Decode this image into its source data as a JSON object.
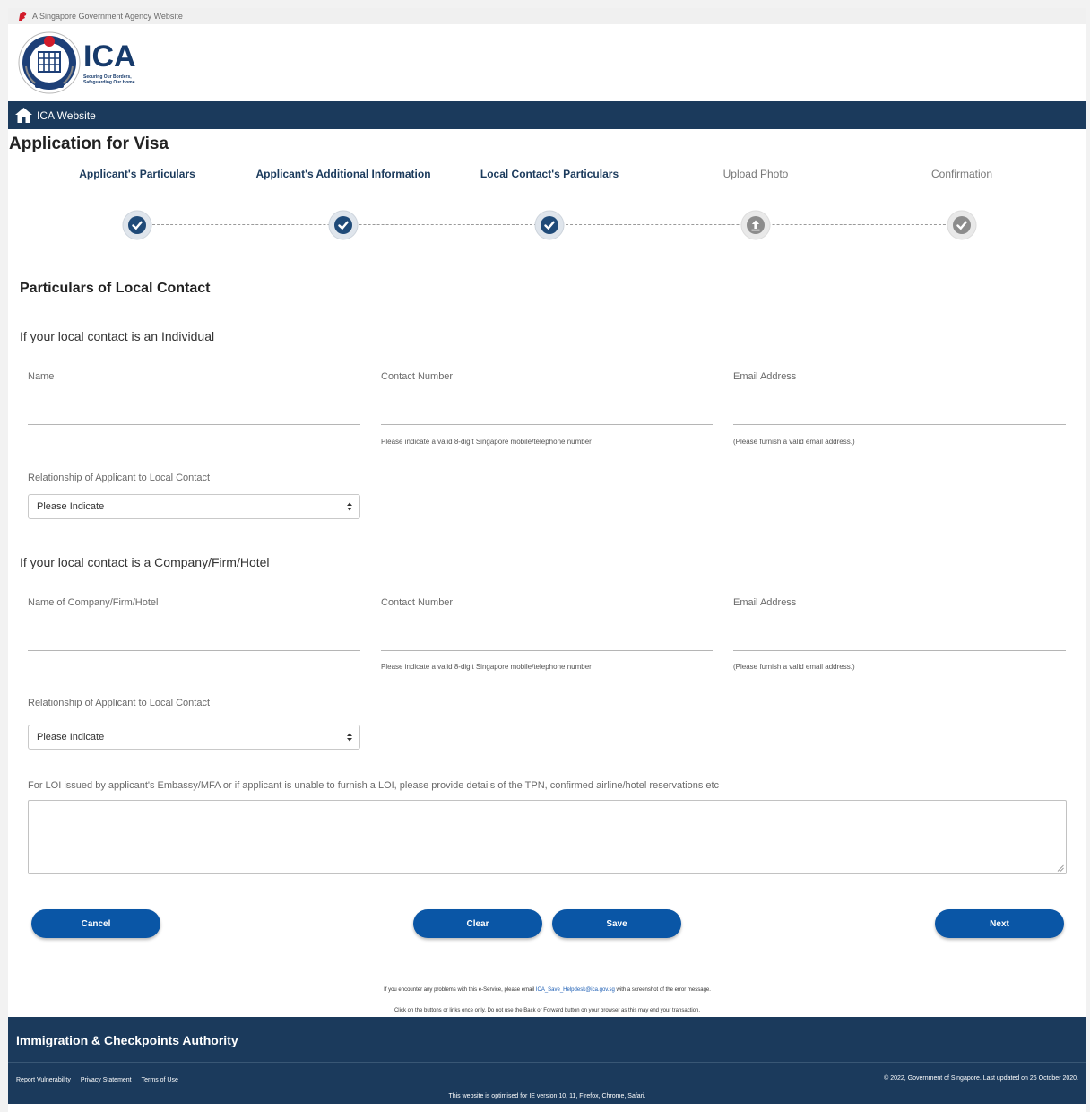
{
  "gov_banner": {
    "text": "A Singapore Government Agency Website"
  },
  "brand": {
    "name": "ICA",
    "tagline_1": "Securing Our Borders,",
    "tagline_2": "Safeguarding Our Home"
  },
  "navbar": {
    "home_label": "ICA Website"
  },
  "page": {
    "title": "Application for Visa"
  },
  "stepper": {
    "steps": [
      {
        "label": "Applicant's Particulars",
        "state": "done"
      },
      {
        "label": "Applicant's Additional Information",
        "state": "done"
      },
      {
        "label": "Local Contact's Particulars",
        "state": "current"
      },
      {
        "label": "Upload Photo",
        "state": "todo"
      },
      {
        "label": "Confirmation",
        "state": "todo"
      }
    ]
  },
  "section": {
    "title": "Particulars of Local Contact",
    "individual": {
      "heading": "If your local contact is an Individual",
      "name_label": "Name",
      "contact_label": "Contact Number",
      "contact_hint": "Please indicate a valid 8-digit Singapore mobile/telephone number",
      "email_label": "Email Address",
      "email_hint": "(Please furnish a valid email address.)",
      "relationship_label": "Relationship of Applicant to Local Contact",
      "relationship_value": "Please Indicate"
    },
    "company": {
      "heading": "If your local contact is a Company/Firm/Hotel",
      "name_label": "Name of Company/Firm/Hotel",
      "contact_label": "Contact Number",
      "contact_hint": "Please indicate a valid 8-digit Singapore mobile/telephone number",
      "email_label": "Email Address",
      "email_hint": "(Please furnish a valid email address.)",
      "relationship_label": "Relationship of Applicant to Local Contact",
      "relationship_value": "Please Indicate"
    },
    "remarks_label": "For LOI issued by applicant's Embassy/MFA or if applicant is unable to furnish a LOI, please provide details of the TPN, confirmed airline/hotel reservations etc"
  },
  "buttons": {
    "cancel": "Cancel",
    "clear": "Clear",
    "save": "Save",
    "next": "Next"
  },
  "notices": {
    "line1_before": "If you encounter any problems with this e-Service, please email",
    "email": "ICA_Save_Helpdesk@ica.gov.sg",
    "line1_after": "with a screenshot of the error message.",
    "line2": "Click on the buttons or links once only. Do not use the Back or Forward button on your browser as this may end your transaction."
  },
  "footer": {
    "org_name": "Immigration & Checkpoints Authority",
    "links": [
      "Report Vulnerability",
      "Privacy Statement",
      "Terms of Use"
    ],
    "copyright": "© 2022, Government of Singapore. Last updated on 26 October 2020.",
    "optimised": "This website is optimised for IE version 10, 11, Firefox, Chrome, Safari."
  },
  "colors": {
    "navy": "#1b3a5c",
    "button_blue": "#0a56a6",
    "step_done": "#1b3a5c",
    "step_todo": "#8c8c8c"
  }
}
